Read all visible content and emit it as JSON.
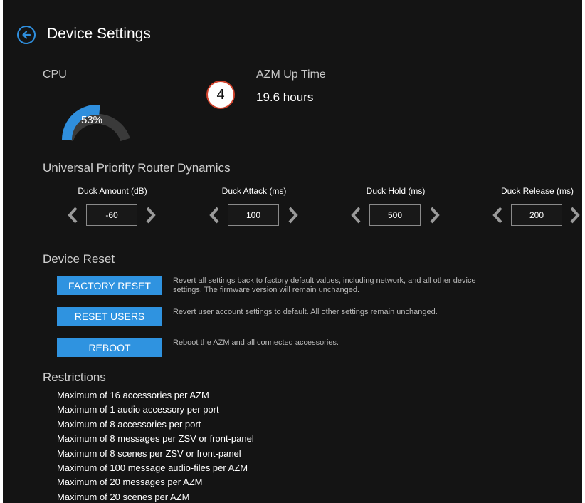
{
  "header": {
    "title": "Device Settings",
    "back_icon": "back-arrow-icon",
    "accent": "#2f8fde"
  },
  "cpu": {
    "label": "CPU",
    "usage_text": "53%",
    "usage_fraction": 0.53
  },
  "step_badge": "4",
  "uptime": {
    "label": "AZM Up Time",
    "value": "19.6 hours"
  },
  "dynamics": {
    "title": "Universal Priority Router Dynamics",
    "controls": [
      {
        "label": "Duck Amount (dB)",
        "value": "-60"
      },
      {
        "label": "Duck Attack (ms)",
        "value": "100"
      },
      {
        "label": "Duck Hold (ms)",
        "value": "500"
      },
      {
        "label": "Duck Release (ms)",
        "value": "200"
      }
    ]
  },
  "reset": {
    "title": "Device Reset",
    "factory_label": "FACTORY RESET",
    "factory_desc_1": "Revert all settings back to factory default values, including network, and all other device",
    "factory_desc_2": "settings. The firmware version will remain unchanged.",
    "users_label": "RESET USERS",
    "users_desc": "Revert user account settings to default. All other settings remain unchanged.",
    "reboot_label": "REBOOT",
    "reboot_desc": "Reboot the AZM and all connected accessories."
  },
  "restrictions": {
    "title": "Restrictions",
    "items": [
      "Maximum of 16 accessories per AZM",
      "Maximum of 1 audio accessory per port",
      "Maximum of 8 accessories per port",
      "Maximum of 8 messages per ZSV or front-panel",
      "Maximum of 8 scenes per ZSV or front-panel",
      "Maximum of 100 message audio-files per AZM",
      "Maximum of 20 messages per AZM",
      "Maximum of 20 scenes per AZM"
    ]
  }
}
